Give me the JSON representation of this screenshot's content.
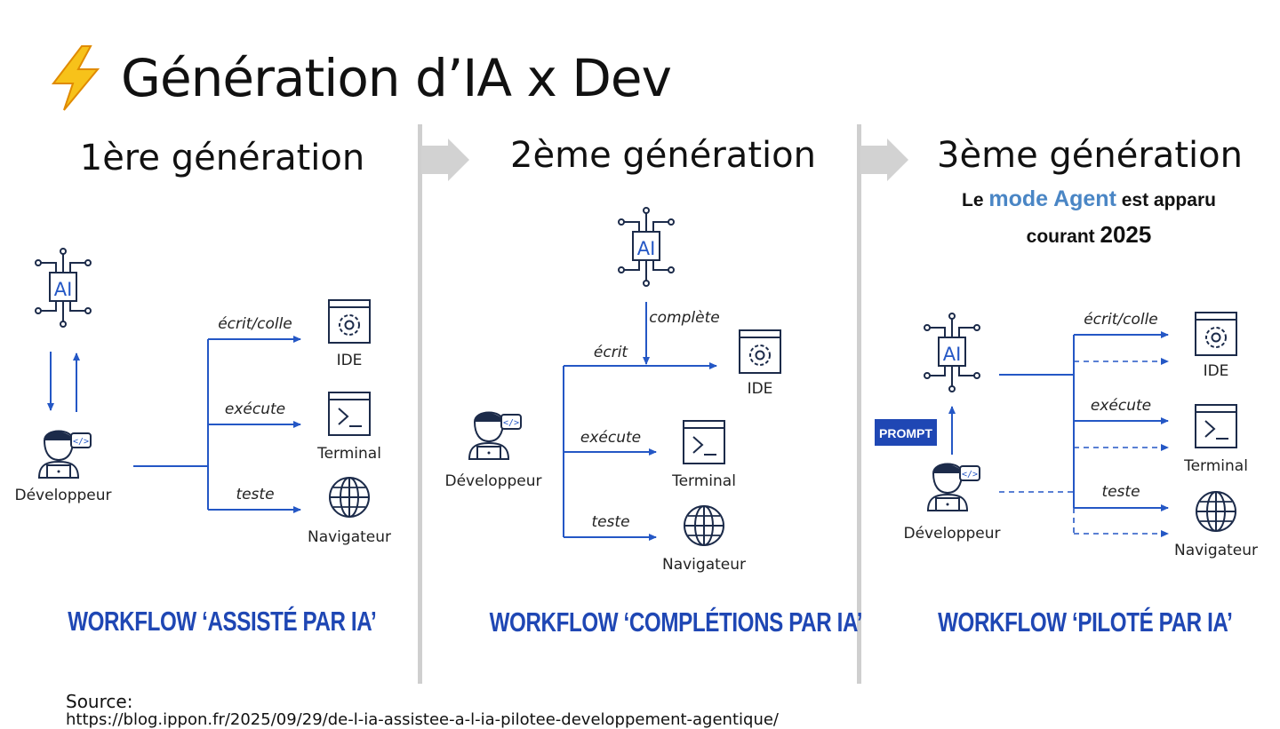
{
  "slide": {
    "title": "Génération d’IA x Dev",
    "title_icon": "lightning-bolt-icon",
    "source_label": "Source:",
    "source_url": "https://blog.ippon.fr/2025/09/29/de-l-ia-assistee-a-l-ia-pilotee-developpement-agentique/"
  },
  "generations": [
    {
      "title": "1ère génération",
      "workflow": "WORKFLOW ‘ASSISTÉ PAR IA’",
      "developer_label": "Développeur",
      "edges": [
        "écrit/colle",
        "exécute",
        "teste"
      ],
      "targets": [
        "IDE",
        "Terminal",
        "Navigateur"
      ]
    },
    {
      "title": "2ème génération",
      "workflow": "WORKFLOW ‘COMPLÉTIONS PAR IA’",
      "developer_label": "Développeur",
      "ai_edge": "complète",
      "edges": [
        "écrit",
        "exécute",
        "teste"
      ],
      "targets": [
        "IDE",
        "Terminal",
        "Navigateur"
      ]
    },
    {
      "title": "3ème génération",
      "subtitle_prefix": "Le ",
      "subtitle_accent": "mode Agent",
      "subtitle_mid": " est apparu",
      "subtitle_line2": "courant ",
      "subtitle_year": "2025",
      "workflow": "WORKFLOW ‘PILOTÉ PAR IA’",
      "developer_label": "Développeur",
      "prompt_label": "PROMPT",
      "edges": [
        "écrit/colle",
        "exécute",
        "teste"
      ],
      "targets": [
        "IDE",
        "Terminal",
        "Navigateur"
      ]
    }
  ],
  "ai_chip_label": "AI",
  "colors": {
    "accent_blue": "#1f47b4",
    "line_blue": "#2457c5",
    "icon_navy": "#1c2b4a",
    "divider_gray": "#cfcfcf",
    "bolt_yellow": "#f5b800",
    "subtitle_accent": "#4a86c5"
  }
}
